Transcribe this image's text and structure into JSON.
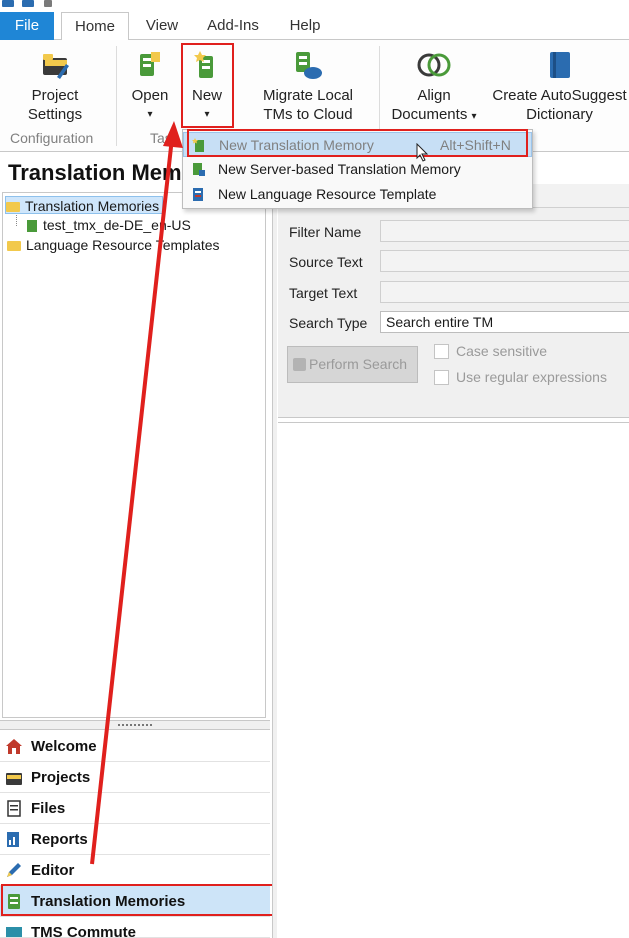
{
  "ribbon_tabs": [
    "File",
    "Home",
    "View",
    "Add-Ins",
    "Help"
  ],
  "ribbon": {
    "project_settings": "Project\nSettings",
    "project_settings_l1": "Project",
    "project_settings_l2": "Settings",
    "open": "Open",
    "new": "New",
    "migrate_l1": "Migrate Local",
    "migrate_l2": "TMs to Cloud",
    "align_l1": "Align",
    "align_l2": "Documents",
    "autosuggest_l1": "Create AutoSuggest",
    "autosuggest_l2": "Dictionary",
    "dropdown_arrow": "▾",
    "group_configuration": "Configuration",
    "group_tasks": "Tas"
  },
  "new_menu": {
    "items": [
      {
        "label": "New Translation Memory",
        "shortcut": "Alt+Shift+N"
      },
      {
        "label": "New Server-based Translation Memory",
        "shortcut": ""
      },
      {
        "label": "New Language Resource Template",
        "shortcut": ""
      }
    ]
  },
  "left_panel": {
    "title": "Translation Memo",
    "tree": [
      {
        "label": "Translation Memories",
        "level": 0,
        "selected": true
      },
      {
        "label": "test_tmx_de-DE_en-US",
        "level": 1,
        "selected": false
      },
      {
        "label": "Language Resource Templates",
        "level": 0,
        "selected": false
      }
    ]
  },
  "search": {
    "filter_name_label": "Filter Name",
    "source_text_label": "Source Text",
    "target_text_label": "Target Text",
    "search_type_label": "Search Type",
    "search_type_value": "Search entire TM",
    "perform_search": "Perform Search",
    "case_sensitive": "Case sensitive",
    "regex": "Use regular expressions"
  },
  "nav": [
    {
      "label": "Welcome",
      "icon": "home-icon",
      "active": false
    },
    {
      "label": "Projects",
      "icon": "projects-icon",
      "active": false
    },
    {
      "label": "Files",
      "icon": "files-icon",
      "active": false
    },
    {
      "label": "Reports",
      "icon": "reports-icon",
      "active": false
    },
    {
      "label": "Editor",
      "icon": "editor-icon",
      "active": false
    },
    {
      "label": "Translation Memories",
      "icon": "translation-memories-icon",
      "active": true
    },
    {
      "label": "TMS Commute",
      "icon": "tms-commute-icon",
      "active": false
    }
  ],
  "colors": {
    "accent": "#1f86d6",
    "highlight": "#e0201d",
    "selection": "#cde4f8"
  }
}
